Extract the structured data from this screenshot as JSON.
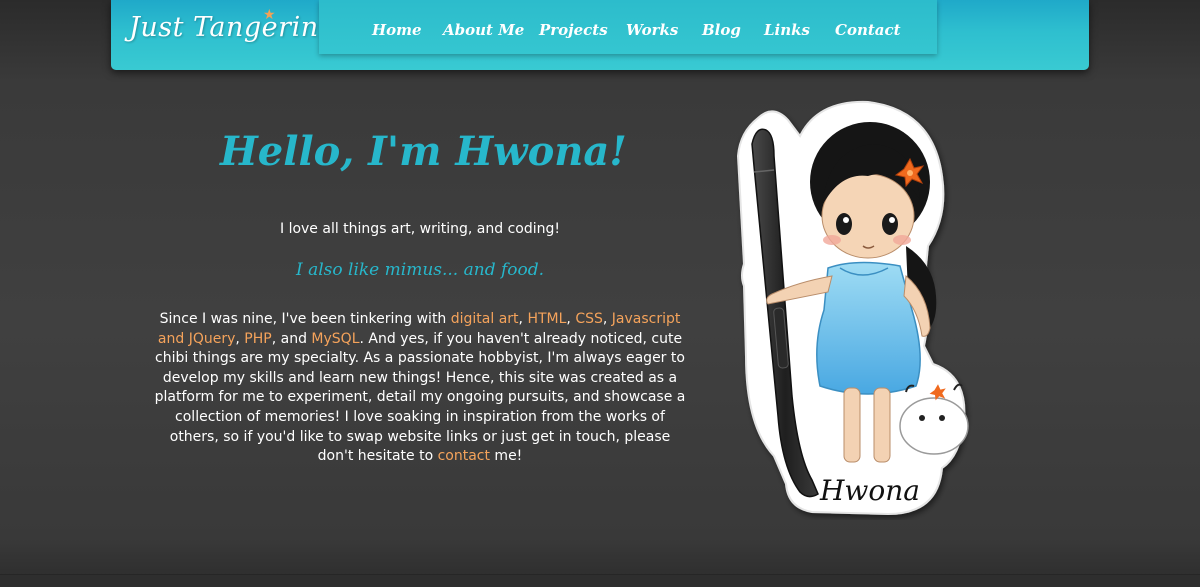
{
  "header": {
    "brand": "Just Tangerine"
  },
  "nav": {
    "items": [
      "Home",
      "About Me",
      "Projects",
      "Works",
      "Blog",
      "Links",
      "Contact"
    ]
  },
  "intro": {
    "title": "Hello, I'm Hwona!",
    "line1": "I love all things art, writing, and coding!",
    "line2": "I also like mimus... and food.",
    "bio": {
      "t0": "Since I was nine, I've been tinkering with ",
      "link_digital_art": "digital art",
      "t1": ", ",
      "link_html": "HTML",
      "t2": ", ",
      "link_css": "CSS",
      "t3": ", ",
      "link_js": "Javascript and JQuery",
      "t4": ", ",
      "link_php": "PHP",
      "t5": ", and ",
      "link_mysql": "MySQL",
      "t6": ". And yes, if you haven't already noticed, cute chibi things are my specialty. As a passionate hobbyist, I'm always eager to develop my skills and learn new things! Hence, this site was created as a platform for me to experiment, detail my ongoing pursuits, and showcase a collection of memories! I love soaking in inspiration from the works of others, so if you'd like to swap website links or just get in touch, please don't hesitate to ",
      "link_contact": "contact",
      "t7": " me!"
    }
  },
  "illustration": {
    "signature": "Hwona"
  },
  "colors": {
    "accent": "#27b7cb",
    "link": "#f5a35b",
    "header": "#2ebfcf",
    "background": "#3d3d3d"
  }
}
